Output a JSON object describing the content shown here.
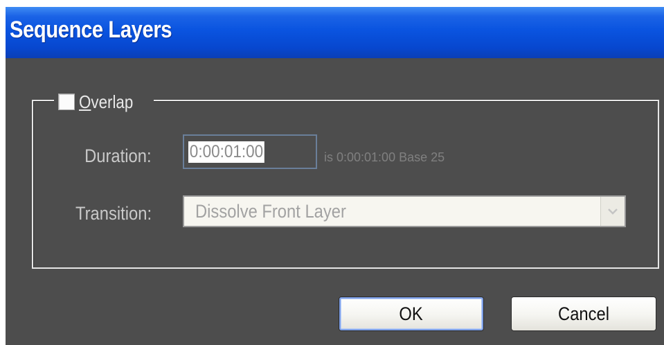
{
  "window": {
    "title": "Sequence Layers"
  },
  "overlap": {
    "label_mnemonic": "O",
    "label_rest": "verlap",
    "checked": false
  },
  "duration": {
    "label": "Duration:",
    "value": "0:00:01:00",
    "info": "is 0:00:01:00  Base 25"
  },
  "transition": {
    "label": "Transition:",
    "selected": "Dissolve Front Layer"
  },
  "buttons": {
    "ok": "OK",
    "cancel": "Cancel"
  },
  "colors": {
    "title_bar": "#0a54e0",
    "dialog_bg": "#4d4d4d"
  },
  "icons": {
    "dropdown": "chevron-down-icon"
  }
}
